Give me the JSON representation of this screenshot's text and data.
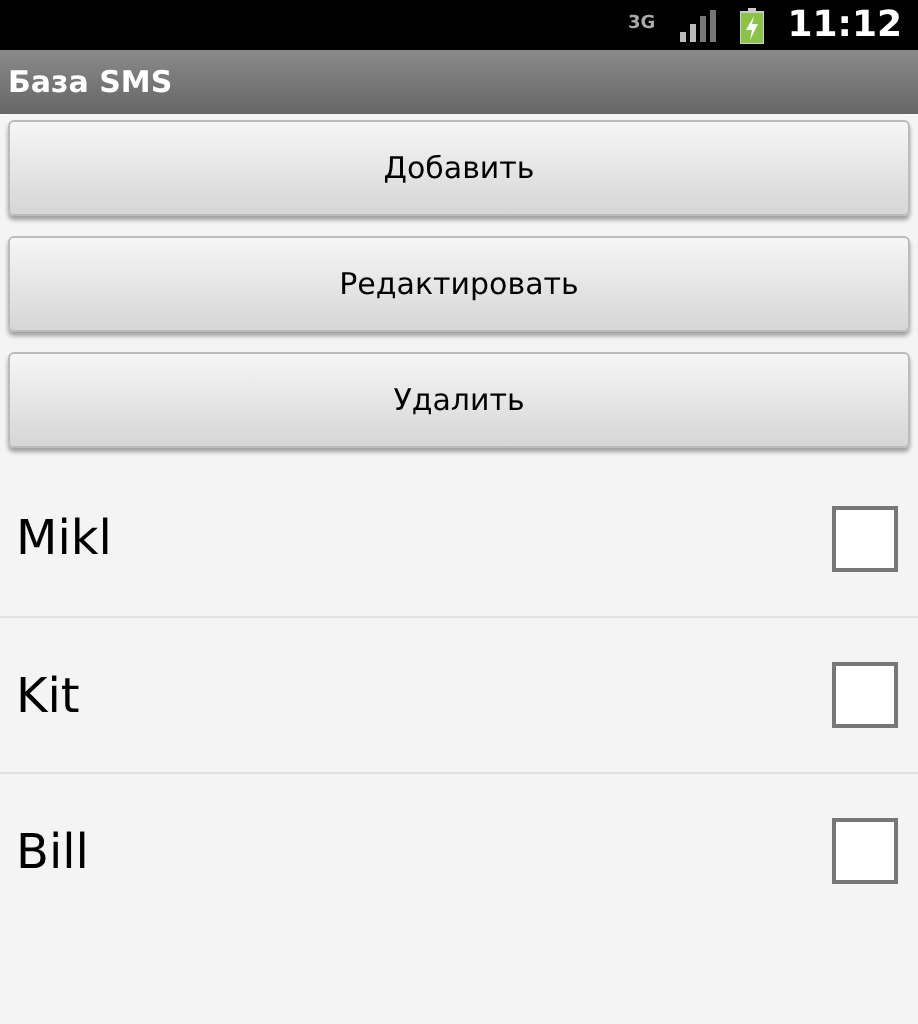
{
  "status_bar": {
    "network": "3G",
    "time": "11:12"
  },
  "title_bar": {
    "title": "База SMS"
  },
  "buttons": [
    {
      "label": "Добавить"
    },
    {
      "label": "Редактировать"
    },
    {
      "label": "Удалить"
    }
  ],
  "contacts": [
    {
      "name": "Mikl",
      "checked": false
    },
    {
      "name": "Kit",
      "checked": false
    },
    {
      "name": "Bill",
      "checked": false
    }
  ]
}
